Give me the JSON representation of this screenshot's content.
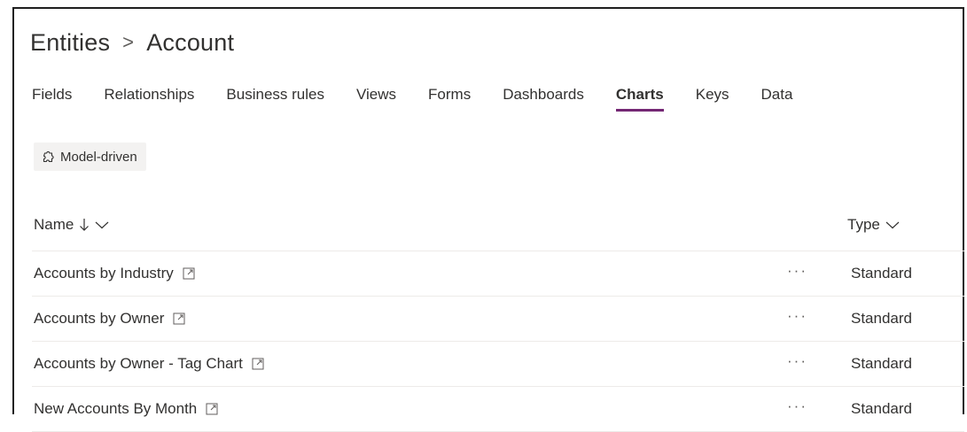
{
  "breadcrumb": {
    "root": "Entities",
    "separator": ">",
    "current": "Account"
  },
  "tabs": [
    {
      "label": "Fields"
    },
    {
      "label": "Relationships"
    },
    {
      "label": "Business rules"
    },
    {
      "label": "Views"
    },
    {
      "label": "Forms"
    },
    {
      "label": "Dashboards"
    },
    {
      "label": "Charts",
      "active": true
    },
    {
      "label": "Keys"
    },
    {
      "label": "Data"
    }
  ],
  "filter_chip": {
    "label": "Model-driven",
    "icon": "puzzle-icon"
  },
  "table": {
    "columns": {
      "name": "Name",
      "type": "Type"
    },
    "sort": {
      "column": "name",
      "direction": "descending"
    },
    "more_label": "···",
    "rows": [
      {
        "name": "Accounts by Industry",
        "type": "Standard"
      },
      {
        "name": "Accounts by Owner",
        "type": "Standard"
      },
      {
        "name": "Accounts by Owner - Tag Chart",
        "type": "Standard"
      },
      {
        "name": "New Accounts By Month",
        "type": "Standard"
      }
    ]
  },
  "colors": {
    "accent": "#742774",
    "text": "#323130",
    "divider": "#edebe9",
    "chip_bg": "#f3f2f1"
  }
}
